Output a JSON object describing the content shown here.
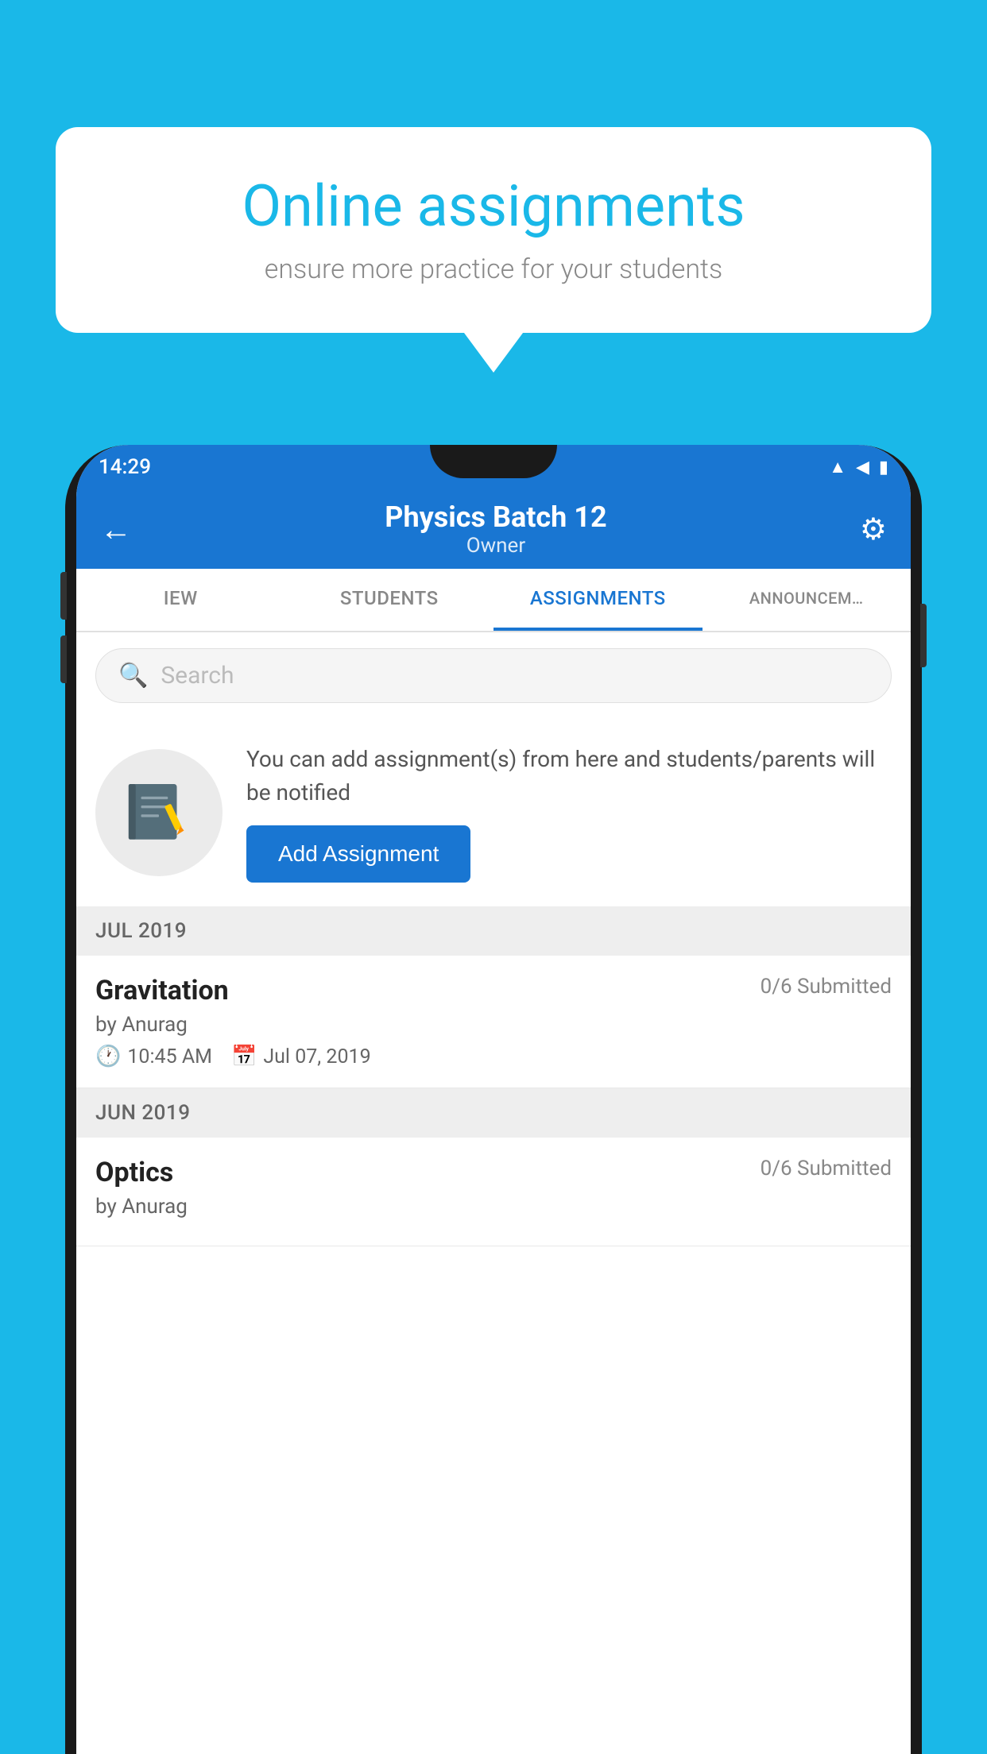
{
  "background_color": "#1ab8e8",
  "speech_bubble": {
    "title": "Online assignments",
    "subtitle": "ensure more practice for your students"
  },
  "phone": {
    "status_bar": {
      "time": "14:29",
      "icons": [
        "wifi",
        "signal",
        "battery"
      ]
    },
    "app_bar": {
      "title": "Physics Batch 12",
      "subtitle": "Owner",
      "back_label": "←",
      "settings_label": "⚙"
    },
    "tabs": [
      {
        "label": "IEW",
        "active": false
      },
      {
        "label": "STUDENTS",
        "active": false
      },
      {
        "label": "ASSIGNMENTS",
        "active": true
      },
      {
        "label": "ANNOUNCEM…",
        "active": false
      }
    ],
    "search": {
      "placeholder": "Search"
    },
    "add_assignment_section": {
      "info_text": "You can add assignment(s) from here and students/parents will be notified",
      "button_label": "Add Assignment"
    },
    "sections": [
      {
        "header": "JUL 2019",
        "assignments": [
          {
            "name": "Gravitation",
            "submitted": "0/6 Submitted",
            "by": "by Anurag",
            "time": "10:45 AM",
            "date": "Jul 07, 2019"
          }
        ]
      },
      {
        "header": "JUN 2019",
        "assignments": [
          {
            "name": "Optics",
            "submitted": "0/6 Submitted",
            "by": "by Anurag",
            "time": "",
            "date": ""
          }
        ]
      }
    ]
  }
}
